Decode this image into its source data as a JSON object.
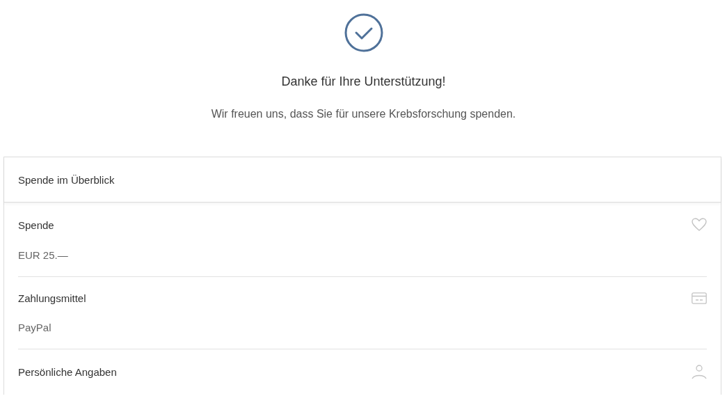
{
  "confirmation": {
    "title": "Danke für Ihre Unterstützung!",
    "message": "Wir freuen uns, dass Sie für unsere Krebsforschung spenden."
  },
  "summary": {
    "title": "Spende im Überblick",
    "sections": [
      {
        "kind": "donation",
        "label": "Spende",
        "value": "EUR 25.—"
      },
      {
        "kind": "payment",
        "label": "Zahlungsmittel",
        "value": "PayPal"
      },
      {
        "kind": "person",
        "label": "Persönliche Angaben"
      }
    ]
  }
}
